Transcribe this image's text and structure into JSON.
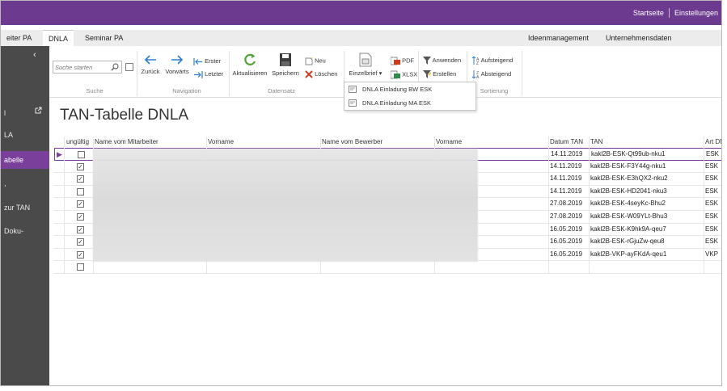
{
  "top_links": {
    "home": "Startseite",
    "settings": "Einstellungen"
  },
  "tabs": [
    {
      "label": "eiter PA"
    },
    {
      "label": "DNLA"
    },
    {
      "label": "Seminar PA"
    }
  ],
  "tabs_right": [
    {
      "label": "Ideenmanagement"
    },
    {
      "label": "Unternehmensdaten"
    }
  ],
  "ribbon": {
    "search_placeholder": "Suche starten",
    "groups": {
      "search": "Suche",
      "navigation": "Navigation",
      "datensatz": "Datensatz",
      "sortierung": "Sortierung"
    },
    "back": "Zurück",
    "forward": "Vorwärts",
    "first": "Erster",
    "last": "Letzter",
    "refresh": "Aktualisieren",
    "save": "Speichern",
    "new": "Neu",
    "delete": "Löschen",
    "single_letter": "Einzelbrief",
    "pdf": "PDF",
    "xlsx": "XLSX",
    "apply": "Anwenden",
    "create": "Erstellen",
    "ascending": "Aufsteigend",
    "descending": "Absteigend"
  },
  "dropdown": {
    "items": [
      "DNLA Einladung BW ESK",
      "DNLA Einladung MA ESK"
    ]
  },
  "sidebar": {
    "collapse": "‹",
    "items": [
      {
        "label": "l"
      },
      {
        "label": "LA"
      },
      {
        "label": "abelle"
      },
      {
        "label": ","
      },
      {
        "label": "zur TAN"
      },
      {
        "label": "Doku-"
      }
    ]
  },
  "page_title": "TAN-Tabelle DNLA",
  "table": {
    "columns": [
      "ungültig",
      "Name vom Mitarbeiter",
      "Vorname",
      "Name vom Bewerber",
      "Vorname",
      "Datum TAN",
      "TAN",
      "Art DN"
    ],
    "rows": [
      {
        "checked": false,
        "date": "14.11.2019",
        "tan": "kakl2B-ESK-Qt99ub-nku1",
        "art": "ESK"
      },
      {
        "checked": true,
        "date": "14.11.2019",
        "tan": "kakl2B-ESK-F3Y44g-nku1",
        "art": "ESK"
      },
      {
        "checked": true,
        "date": "14.11.2019",
        "tan": "kakl2B-ESK-E3hQX2-nku2",
        "art": "ESK"
      },
      {
        "checked": false,
        "date": "14.11.2019",
        "tan": "kakl2B-ESK-HD2041-nku3",
        "art": "ESK"
      },
      {
        "checked": true,
        "date": "27.08.2019",
        "tan": "kakl2B-ESK-4seyKc-Bhu2",
        "art": "ESK"
      },
      {
        "checked": true,
        "date": "27.08.2019",
        "tan": "kakl2B-ESK-W09YLt-Bhu3",
        "art": "ESK"
      },
      {
        "checked": true,
        "date": "16.05.2019",
        "tan": "kakl2B-ESK-K9hk9A-qeu7",
        "art": "ESK"
      },
      {
        "checked": true,
        "date": "16.05.2019",
        "tan": "kakl2B-ESK-rGjuZw-qeu8",
        "art": "ESK"
      },
      {
        "checked": true,
        "date": "16.05.2019",
        "tan": "kakl2B-VKP-ayFKdA-qeu1",
        "art": "VKP"
      },
      {
        "checked": false,
        "date": "",
        "tan": "",
        "art": ""
      }
    ]
  }
}
